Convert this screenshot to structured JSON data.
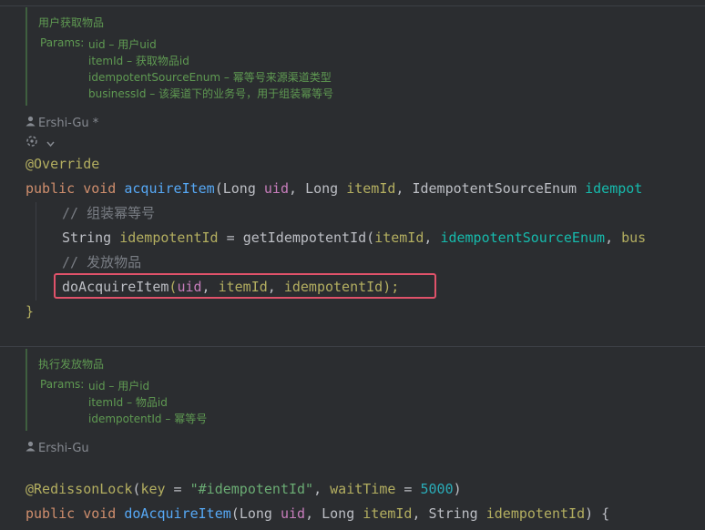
{
  "doc1": {
    "title": "用户获取物品",
    "params_label": "Params:",
    "params": [
      {
        "name": "uid",
        "desc": "– 用户uid"
      },
      {
        "name": "itemId",
        "desc": "– 获取物品id"
      },
      {
        "name": "idempotentSourceEnum",
        "desc": "– 幂等号来源渠道类型"
      },
      {
        "name": "businessId",
        "desc": "– 该渠道下的业务号，用于组装幂等号"
      }
    ]
  },
  "author1": "Ershi-Gu *",
  "author2": "Ershi-Gu",
  "code1": {
    "annotation": "@Override",
    "signature": {
      "public": "public",
      "void": "void",
      "method": "acquireItem",
      "lparen": "(",
      "t1": "Long",
      "p1": "uid",
      "comma1": ",",
      "t2": "Long",
      "p2": "itemId",
      "comma2": ",",
      "t3": "IdempotentSourceEnum",
      "p3": "idempot"
    },
    "comment1": "// 组装幂等号",
    "line2": {
      "type": "String",
      "var": "idempotentId",
      "eq": " = ",
      "call": "getIdempotentId",
      "lparen": "(",
      "a1": "itemId",
      "comma1": ", ",
      "a2": "idempotentSourceEnum",
      "comma2": ", ",
      "a3": "bus"
    },
    "comment2": "// 发放物品",
    "line3": {
      "call": "doAcquireItem",
      "lparen": "(",
      "a1": "uid",
      "comma1": ", ",
      "a2": "itemId",
      "comma2": ", ",
      "a3": "idempotentId",
      "end": ");"
    },
    "close": "}"
  },
  "doc2": {
    "title": "执行发放物品",
    "params_label": "Params:",
    "params": [
      {
        "name": "uid",
        "desc": "– 用户id"
      },
      {
        "name": "itemId",
        "desc": "– 物品id"
      },
      {
        "name": "idempotentId",
        "desc": "– 幂等号"
      }
    ]
  },
  "code2": {
    "annotation": "@RedissonLock",
    "ann_args": {
      "lparen": "(",
      "k1": "key",
      "eq1": " = ",
      "v1": "\"#idempotentId\"",
      "comma": ", ",
      "k2": "waitTime",
      "eq2": " = ",
      "v2": "5000",
      "rparen": ")"
    },
    "signature": {
      "public": "public",
      "void": "void",
      "method": "doAcquireItem",
      "lparen": "(",
      "t1": "Long",
      "p1": "uid",
      "comma1": ", ",
      "t2": "Long",
      "p2": "itemId",
      "comma2": ", ",
      "t3": "String",
      "p3": "idempotentId",
      "end": ") {"
    }
  },
  "colors": {
    "background": "#2b2d30",
    "keyword": "#cf8e6d",
    "annotation": "#b3ae60",
    "method_decl": "#56a8f5",
    "parameter": "#c77dbb",
    "comment": "#7a7e85",
    "string": "#6aab73",
    "number": "#2aacb8",
    "doc_comment": "#5f9a52",
    "highlight_box": "#e0526a"
  }
}
